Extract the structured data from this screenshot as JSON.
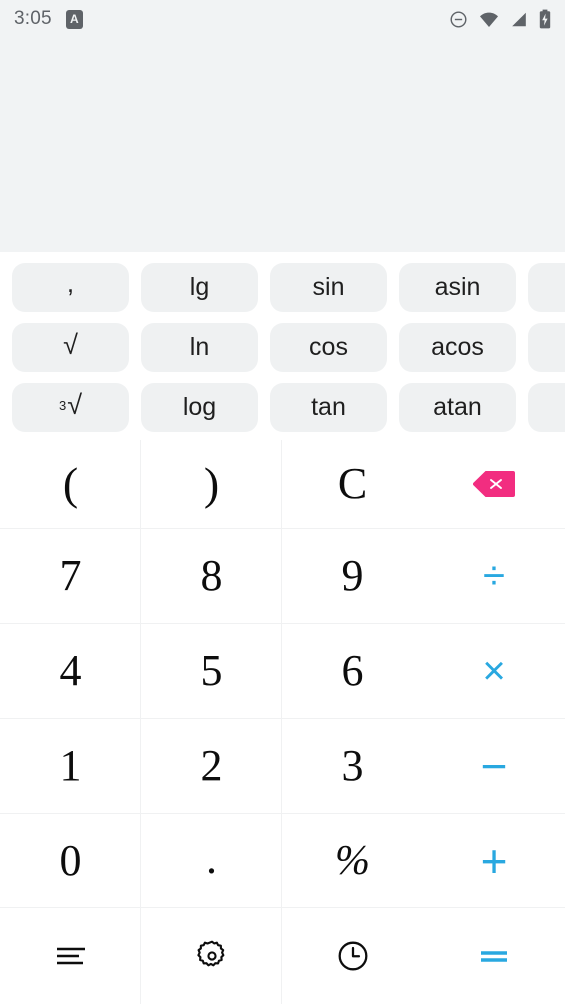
{
  "status_bar": {
    "time": "3:05",
    "notification_icon_letter": "A",
    "icons": [
      "dnd-icon",
      "wifi-icon",
      "signal-icon",
      "battery-charging-icon"
    ]
  },
  "display": {
    "expression": "",
    "result": ""
  },
  "function_chips": {
    "rows": [
      [
        {
          "label": ",",
          "name": "chip-comma"
        },
        {
          "label": "lg",
          "name": "chip-lg"
        },
        {
          "label": "sin",
          "name": "chip-sin"
        },
        {
          "label": "asin",
          "name": "chip-asin"
        },
        {
          "label": "",
          "name": "chip-offscreen-1"
        }
      ],
      [
        {
          "label": "√",
          "name": "chip-sqrt"
        },
        {
          "label": "ln",
          "name": "chip-ln"
        },
        {
          "label": "cos",
          "name": "chip-cos"
        },
        {
          "label": "acos",
          "name": "chip-acos"
        },
        {
          "label": "",
          "name": "chip-offscreen-2"
        }
      ],
      [
        {
          "label": "∛",
          "name": "chip-cbrt"
        },
        {
          "label": "log",
          "name": "chip-log"
        },
        {
          "label": "tan",
          "name": "chip-tan"
        },
        {
          "label": "atan",
          "name": "chip-atan"
        },
        {
          "label": "",
          "name": "chip-offscreen-3"
        }
      ]
    ],
    "cube_root_degree": "3",
    "radical_symbol": "√"
  },
  "keypad": {
    "row_paren": {
      "open_paren": "(",
      "close_paren": ")",
      "clear": "C",
      "backspace": "backspace-icon"
    },
    "row_789": {
      "k1": "7",
      "k2": "8",
      "k3": "9",
      "op": "÷"
    },
    "row_456": {
      "k1": "4",
      "k2": "5",
      "k3": "6",
      "op": "×"
    },
    "row_123": {
      "k1": "1",
      "k2": "2",
      "k3": "3",
      "op": "−"
    },
    "row_0dot": {
      "k1": "0",
      "k2": ".",
      "k3": "%",
      "op": "+"
    }
  },
  "bottom_bar": {
    "menu_label": "menu-icon",
    "settings_label": "gear-icon",
    "history_label": "history-clock-icon",
    "equals_label": "="
  },
  "colors": {
    "operator_blue": "#29A8E0",
    "backspace_pink": "#F22D80",
    "display_background": "#F1F3F4",
    "chip_background": "#EFF1F2",
    "divider": "#F0F1F2",
    "text_dark": "#0d0d0d",
    "status_text": "#5F6368"
  }
}
